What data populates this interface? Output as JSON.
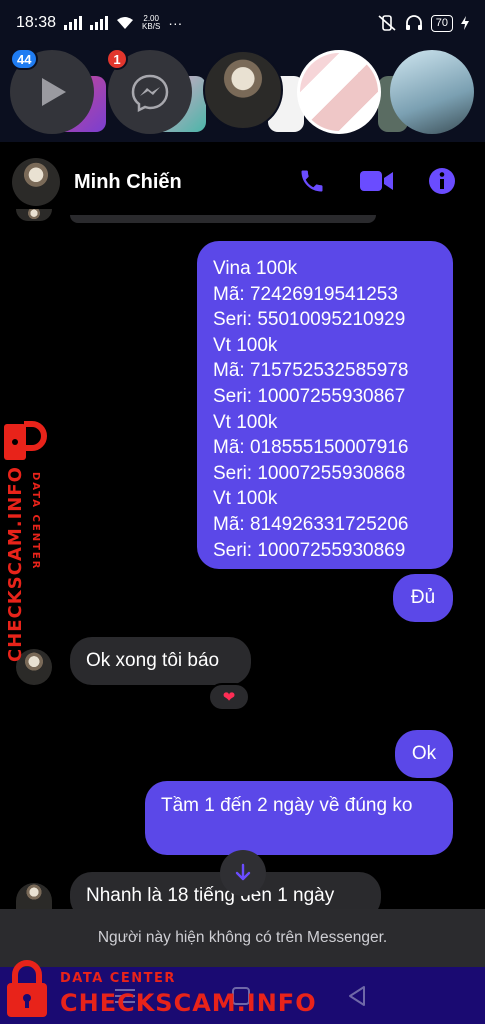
{
  "status_bar": {
    "time": "18:38",
    "net_speed_value": "2.00",
    "net_speed_unit": "KB/S",
    "more": "···",
    "battery": "70"
  },
  "chat_heads": {
    "badge_first": "44",
    "badge_second": "1"
  },
  "header": {
    "contact_name": "Minh Chiến",
    "icons": [
      "phone-icon",
      "video-icon",
      "info-icon"
    ]
  },
  "messages": {
    "card_block": [
      "Vina 100k",
      "Mã: 72426919541253",
      "Seri: 55010095210929",
      "Vt 100k",
      "Mã: 715752532585978",
      "Seri: 10007255930867",
      "Vt 100k",
      "Mã: 018555150007916",
      "Seri: 10007255930868",
      "Vt 100k",
      "Mã: 814926331725206",
      "Seri: 10007255930869"
    ],
    "enough": "Đủ",
    "in_ok_report": "Ok xong tôi báo",
    "reaction": "❤",
    "out_ok": "Ok",
    "out_question": "Tầm 1 đến 2 ngày về đúng ko",
    "in_fast": "Nhanh là 18 tiếng đến 1 ngày"
  },
  "info_bar": {
    "text": "Người này hiện không có trên Messenger."
  },
  "watermark": {
    "small_label": "DATA CENTER",
    "brand": "CHECKSCAM.INFO"
  },
  "colors": {
    "outgoing_bubble": "#5b48e8",
    "incoming_bubble": "#2a2a2d",
    "accent_icon": "#6a4cff",
    "watermark_red": "#e8231a",
    "nav_bar": "#1a0a72"
  }
}
